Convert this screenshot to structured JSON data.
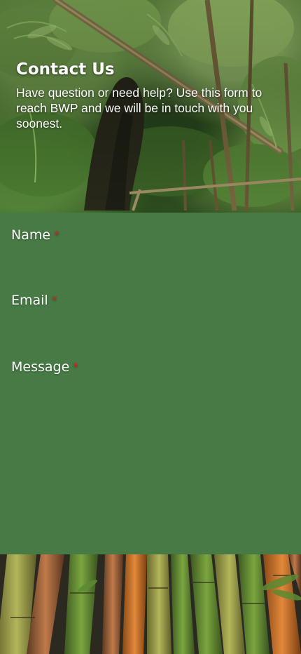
{
  "hero": {
    "title": "Contact Us",
    "subtitle": "Have question or need help? Use this form to reach BWP and we will be in touch with you soonest."
  },
  "form": {
    "fields": [
      {
        "label": "Name",
        "required_mark": "*",
        "value": "",
        "type": "text"
      },
      {
        "label": "Email",
        "required_mark": "*",
        "value": "",
        "type": "email"
      },
      {
        "label": "Message",
        "required_mark": "*",
        "value": "",
        "type": "textarea"
      }
    ]
  },
  "colors": {
    "panel_green": "#477a45",
    "label_text": "#ffffff",
    "required_red": "#c62828"
  }
}
